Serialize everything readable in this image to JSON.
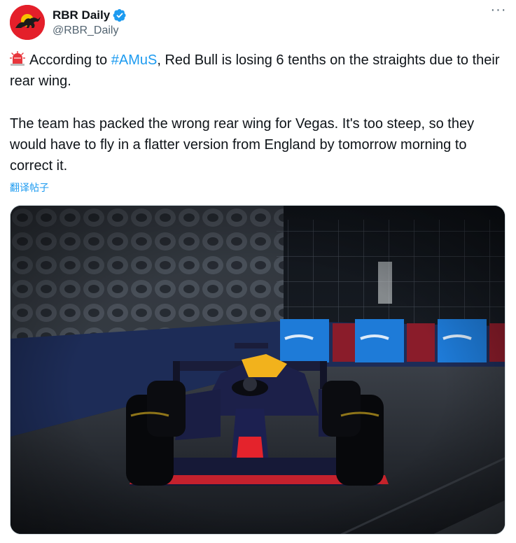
{
  "author": {
    "display_name": "RBR Daily",
    "handle": "@RBR_Daily",
    "verified_icon": "verified-badge-icon",
    "avatar_icon": "red-bull-logo"
  },
  "more_icon": "more-options-icon",
  "tweet": {
    "siren_icon": "rotating-light-emoji",
    "line1_before": "According to ",
    "hashtag": "#AMuS",
    "line1_after": ", Red Bull is losing 6 tenths on the straights due to their rear wing.",
    "paragraph2": "The team has packed the wrong rear wing for Vegas. It's too steep, so they would have to fly in a flatter version from England by tomorrow morning to correct it."
  },
  "translate_label": "翻译帖子",
  "media": {
    "type": "photo",
    "subject": "Red Bull F1 car on track at night"
  },
  "colors": {
    "accent": "#1d9bf0",
    "text": "#0f1419",
    "secondary_text": "#536471",
    "avatar_bg": "#e41f2a"
  }
}
